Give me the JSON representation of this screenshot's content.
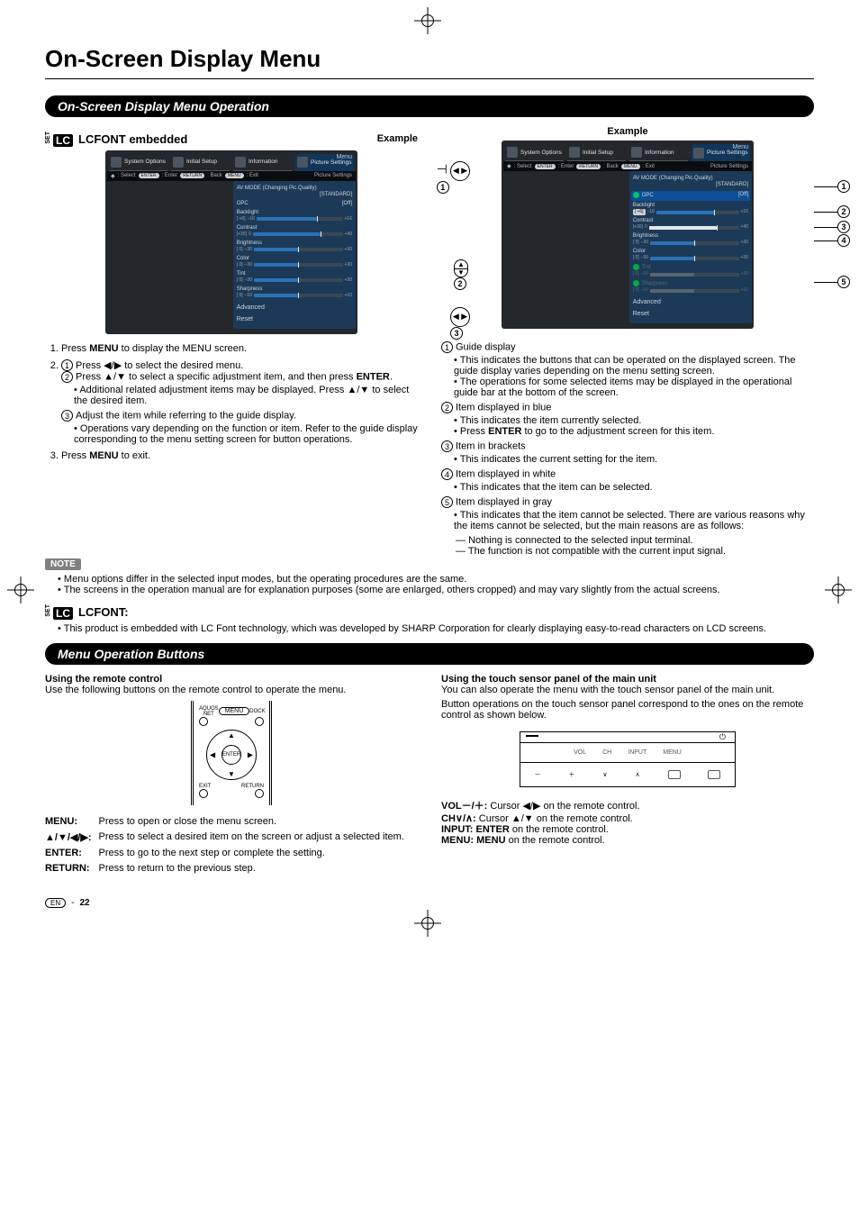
{
  "page": {
    "title": "On-Screen Display Menu",
    "section1": "On-Screen Display Menu Operation",
    "section2": "Menu Operation Buttons",
    "example": "Example",
    "lcfont_embedded": "LCFONT embedded",
    "lcfont_heading": "LCFONT:",
    "note": "NOTE",
    "footer_page": "22"
  },
  "osd": {
    "menu_label": "Menu",
    "tabs": [
      "System\nOptions",
      "Initial\nSetup",
      "Information",
      "Picture\nSettings"
    ],
    "guide": {
      "select": ": Select",
      "enter": ": Enter",
      "back": ": Back",
      "exit": ": Exit",
      "enter_pill": "ENTER",
      "return_pill": "RETURN",
      "menu_pill": "MENU"
    },
    "panel_head": "Picture Settings",
    "rows": [
      {
        "label": "AV MODE (Changing Pic.Quality)",
        "setting": "[STANDARD]"
      },
      {
        "label": "OPC",
        "setting": "[Off]",
        "highlight_b": true,
        "green": true
      },
      {
        "label": "Backlight",
        "cur": "[ +6]",
        "lo": "–16",
        "hi": "+16",
        "pct": 70,
        "bracket_b": true
      },
      {
        "label": "Contrast",
        "cur": "[+30]",
        "lo": "0",
        "hi": "+40",
        "pct": 75,
        "white_b": true
      },
      {
        "label": "Brightness",
        "cur": "[   0]",
        "lo": "–30",
        "hi": "+30",
        "pct": 50
      },
      {
        "label": "Color",
        "cur": "[   0]",
        "lo": "–30",
        "hi": "+30",
        "pct": 50
      },
      {
        "label": "Tint",
        "cur": "[   0]",
        "lo": "–30",
        "hi": "+30",
        "pct": 50,
        "gray_b": true,
        "green": true
      },
      {
        "label": "Sharpness",
        "cur": "[   0]",
        "lo": "–10",
        "hi": "+10",
        "pct": 50,
        "gray_b": true,
        "green": true
      }
    ],
    "plain": [
      "Advanced",
      "Reset"
    ]
  },
  "steps": {
    "s1": "Press MENU to display the MENU screen.",
    "s2_1": "Press ◀/▶ to select the desired menu.",
    "s2_2": "Press ▲/▼ to select a specific adjustment item, and then press ENTER.",
    "s2_2b": "Additional related adjustment items may be displayed. Press ▲/▼ to select the desired item.",
    "s2_3": "Adjust the item while referring to the guide display.",
    "s2_3b": "Operations vary depending on the function or item. Refer to the guide display corresponding to the menu setting screen for button operations.",
    "s3": "Press MENU to exit."
  },
  "guide_list": {
    "g1": "Guide display",
    "g1_a": "This indicates the buttons that can be operated on the displayed screen. The guide display varies depending on the menu setting screen.",
    "g1_b": "The operations for some selected items may be displayed in the operational guide bar at the bottom of the screen.",
    "g2": "Item displayed in blue",
    "g2_a": "This indicates the item currently selected.",
    "g2_b": "Press ENTER to go to the adjustment screen for this item.",
    "g3": "Item in brackets",
    "g3_a": "This indicates the current setting for the item.",
    "g4": "Item displayed in white",
    "g4_a": "This indicates that the item can be selected.",
    "g5": "Item displayed in gray",
    "g5_a": "This indicates that the item cannot be selected. There are various reasons why the items cannot be selected, but the main reasons are as follows:",
    "g5_b": "Nothing is connected to the selected input terminal.",
    "g5_c": "The function is not compatible with the current input signal."
  },
  "notes": {
    "n1": "Menu options differ in the selected input modes, but the operating procedures are the same.",
    "n2": "The screens in the operation manual are for explanation purposes (some are enlarged, others cropped) and may vary slightly from the actual screens.",
    "lc": "This product is embedded with LC Font technology, which was developed by SHARP Corporation for clearly displaying easy-to-read characters on LCD screens."
  },
  "remote_section": {
    "heading": "Using the remote control",
    "lead": "Use the following buttons on the remote control to operate the menu.",
    "labels": {
      "aquos": "AQUOS\nNET",
      "menu": "MENU",
      "dock": "DOCK",
      "enter": "ENTER",
      "exit": "EXIT",
      "return": "RETURN"
    },
    "defs": {
      "menu": "Press to open or close the menu screen.",
      "arrows": "Press to select a desired item on the screen or adjust a selected item.",
      "enter": "Press to go to the next step or complete the setting.",
      "return": "Press to return to the previous step."
    },
    "keys": {
      "menu": "MENU:",
      "arrows": "▲/▼/◀/▶:",
      "enter": "ENTER:",
      "return": "RETURN:"
    }
  },
  "touch_section": {
    "heading": "Using the touch sensor panel of the main unit",
    "p1": "You can also operate the menu with the touch sensor panel of the main unit.",
    "p2": "Button operations on the touch sensor panel correspond to the ones on the remote control as shown below.",
    "labs": {
      "vol": "VOL",
      "ch": "CH",
      "input": "INPUT",
      "menu": "MENU"
    },
    "map": {
      "vol": {
        "k": "VOL－/＋:",
        "v": "Cursor ◀/▶ on the remote control."
      },
      "ch": {
        "k": "CH∨/∧:",
        "v": "Cursor ▲/▼ on the remote control."
      },
      "input": {
        "k": "INPUT:",
        "v": "ENTER on the remote control."
      },
      "menu": {
        "k": "MENU:",
        "v": "MENU on the remote control."
      }
    }
  }
}
